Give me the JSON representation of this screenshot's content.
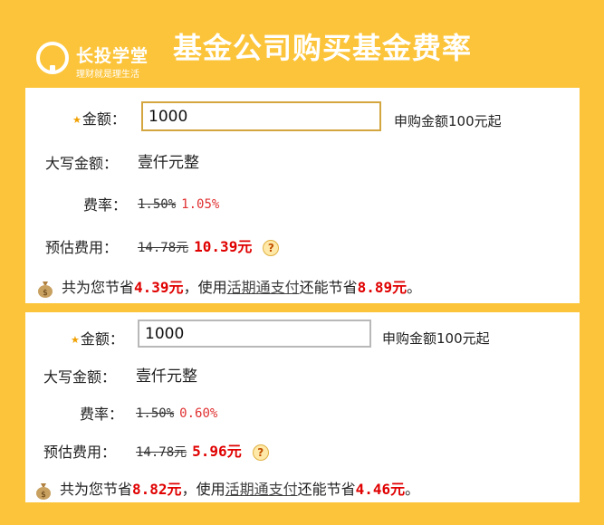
{
  "header": {
    "logo_name": "长投学堂",
    "logo_slogan": "理财就是理生活",
    "title": "基金公司购买基金费率"
  },
  "panels": [
    {
      "amount_label": "金额：",
      "amount_value": "1000",
      "amount_hint": "申购金额100元起",
      "chinese_amount_label": "大写金额：",
      "chinese_amount_value": "壹仟元整",
      "rate_label": "费率：",
      "rate_original": "1.50%",
      "rate_discount": "1.05%",
      "fee_label": "预估费用：",
      "fee_original": "14.78元",
      "fee_discount": "10.39元",
      "help_icon": "?",
      "saving_prefix": "共为您节省",
      "saving_amount": "4.39元",
      "saving_mid": "，使用",
      "saving_link": "活期通支付",
      "saving_more": "还能节省",
      "saving_more_amount": "8.89元",
      "saving_end": "。"
    },
    {
      "amount_label": "金额：",
      "amount_value": "1000",
      "amount_hint": "申购金额100元起",
      "chinese_amount_label": "大写金额：",
      "chinese_amount_value": "壹仟元整",
      "rate_label": "费率：",
      "rate_original": "1.50%",
      "rate_discount": "0.60%",
      "fee_label": "预估费用：",
      "fee_original": "14.78元",
      "fee_discount": "5.96元",
      "help_icon": "?",
      "saving_prefix": "共为您节省",
      "saving_amount": "8.82元",
      "saving_mid": "，使用",
      "saving_link": "活期通支付",
      "saving_more": "还能节省",
      "saving_more_amount": "4.46元",
      "saving_end": "。"
    }
  ],
  "colors": {
    "background": "#FCC43A",
    "highlight_red": "#e00000",
    "rate_red": "#e03030"
  },
  "icons": {
    "logo": "lightbulb-logo-icon",
    "required": "star-icon",
    "help": "question-icon",
    "saving": "money-bag-icon"
  }
}
